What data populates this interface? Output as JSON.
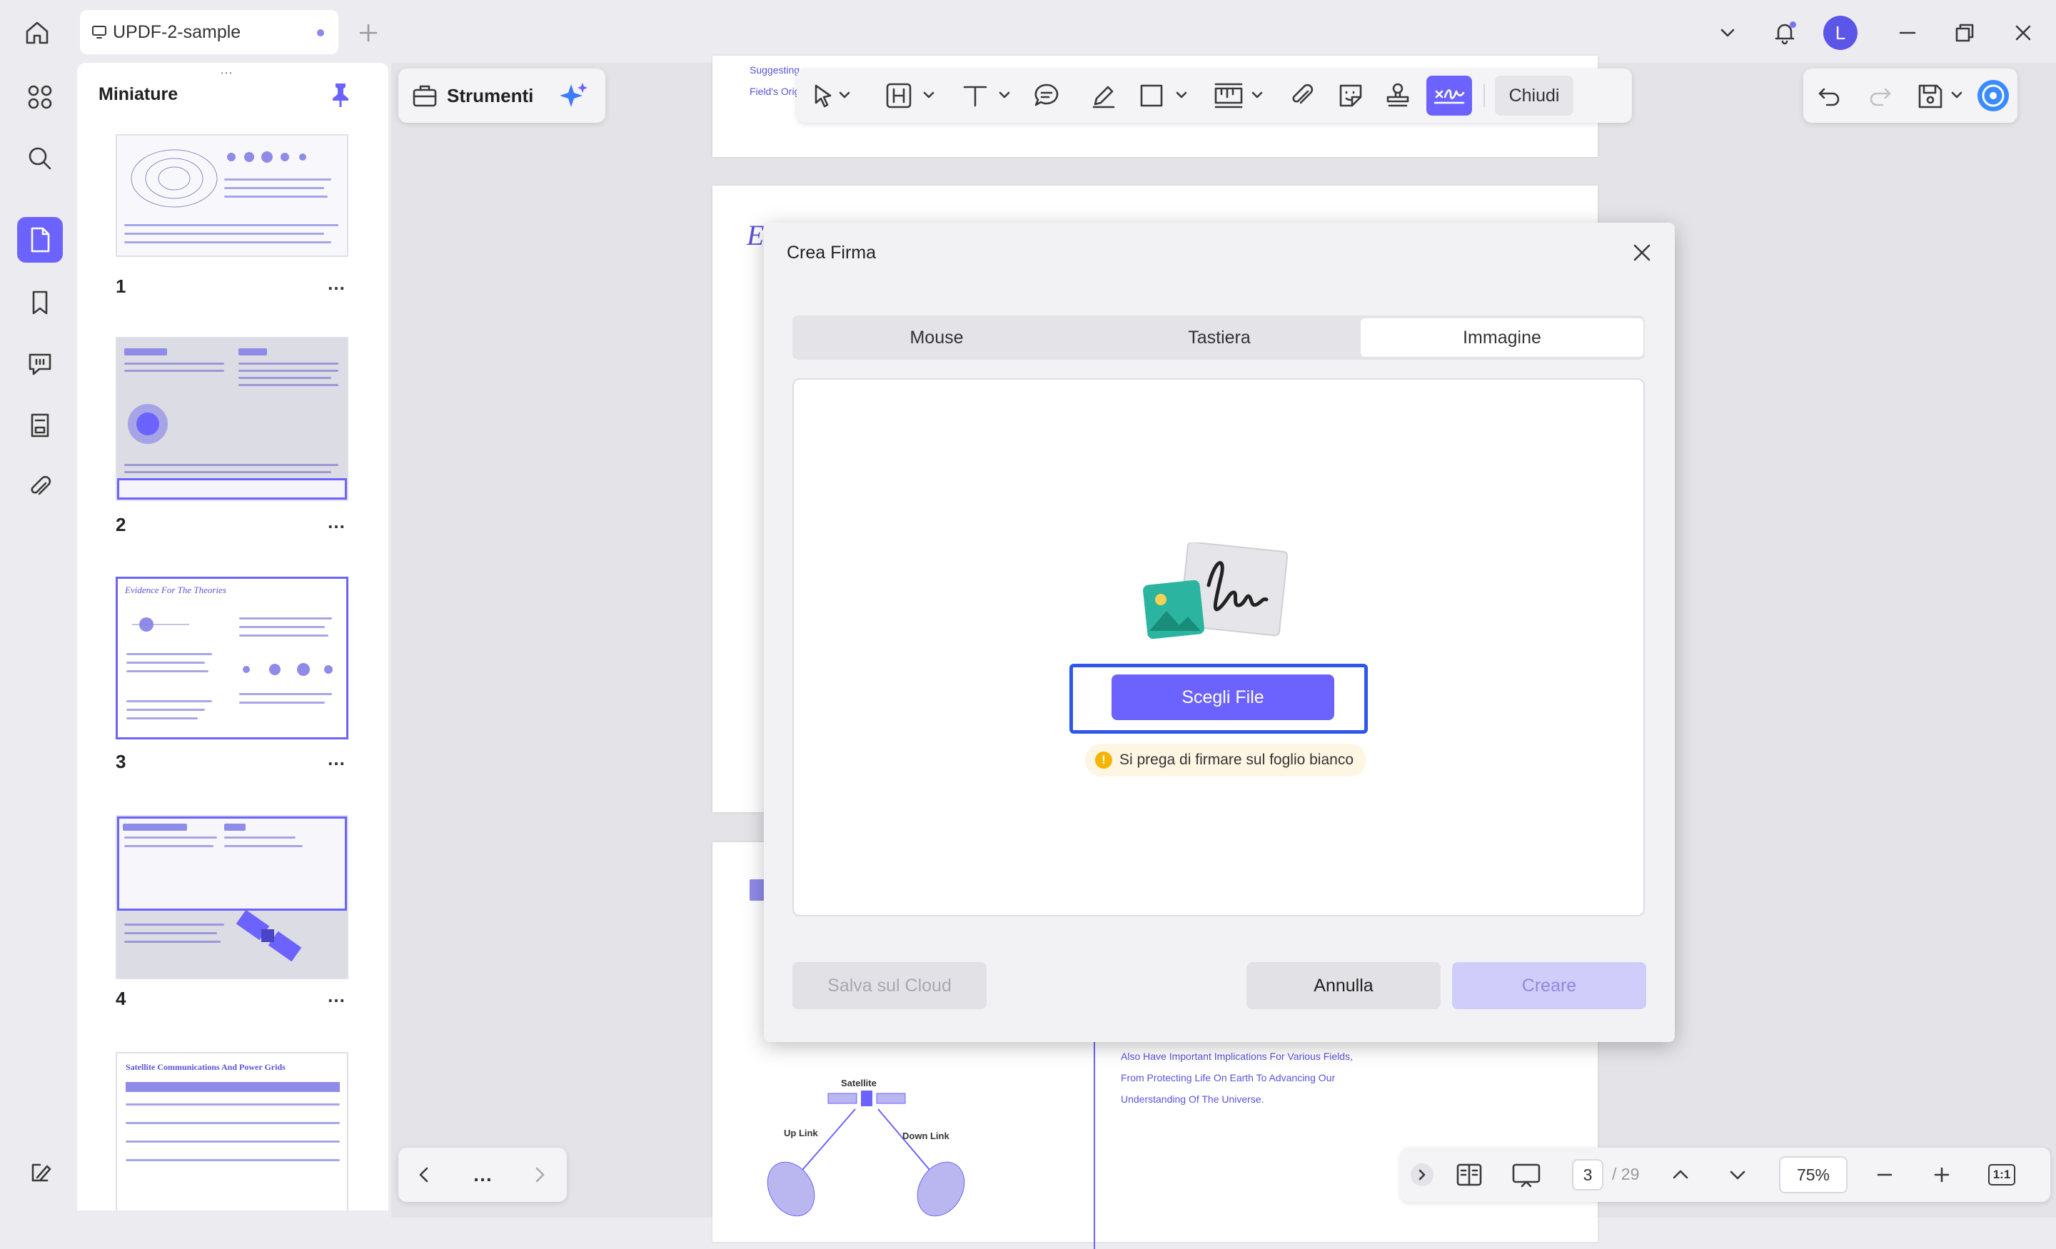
{
  "titlebar": {
    "tab_title": "UPDF-2-sample",
    "avatar_letter": "L"
  },
  "thumbnails": {
    "panel_title": "Miniature",
    "items": [
      {
        "number": "1",
        "more": "…"
      },
      {
        "number": "2",
        "more": "…"
      },
      {
        "number": "3",
        "more": "…"
      },
      {
        "number": "4",
        "more": "…"
      }
    ],
    "page3_heading": "Evidence For The Theories",
    "page5_heading": "Satellite Communications And Power Grids"
  },
  "toolbar": {
    "strumenti_label": "Strumenti",
    "chiudi_label": "Chiudi"
  },
  "document": {
    "top_text_1": "Suggesting",
    "top_text_2": "Field's Orig",
    "bottom_right_lines": [
      "Also Have Important Implications For Various Fields,",
      "From Protecting Life On Earth To Advancing Our",
      "Understanding Of The Universe."
    ],
    "diagram_satellite": "Satellite",
    "diagram_uplink": "Up Link",
    "diagram_downlink": "Down Link"
  },
  "modal": {
    "title": "Crea Firma",
    "tabs": [
      "Mouse",
      "Tastiera",
      "Immagine"
    ],
    "active_tab": "Immagine",
    "choose_file_label": "Scegli File",
    "hint_text": "Si prega di firmare sul foglio bianco",
    "save_cloud_label": "Salva sul Cloud",
    "cancel_label": "Annulla",
    "create_label": "Creare"
  },
  "nav": {
    "more": "…",
    "current_page": "3",
    "total_pages": "/ 29",
    "zoom": "75%",
    "fit_label": "1:1"
  },
  "colors": {
    "accent": "#6c63ff",
    "focus_ring": "#3056e8",
    "hint_bg": "#fdf6e3"
  }
}
